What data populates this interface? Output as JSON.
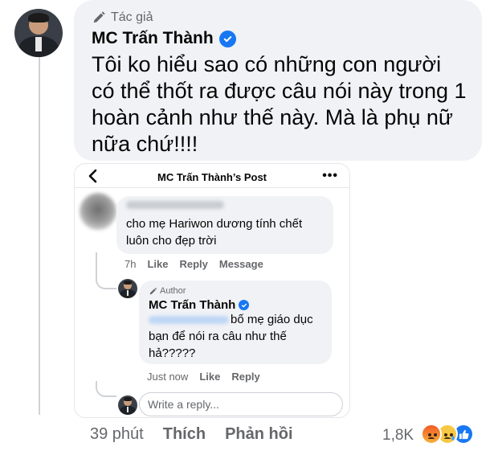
{
  "comment": {
    "badge": "Tác giả",
    "author": "MC Trấn Thành",
    "text": "Tôi ko hiểu sao có những con người có thể thốt ra được câu nói này trong 1 hoàn cảnh như thế này. Mà là phụ nữ nữa chứ!!!!",
    "time": "39 phút",
    "like_label": "Thích",
    "reply_label": "Phản hồi",
    "reaction_count": "1,8K",
    "reactions": [
      "angry-icon",
      "sad-icon",
      "like-icon"
    ]
  },
  "screenshot": {
    "title": "MC Trấn Thành’s Post",
    "comment1": {
      "text": "cho mẹ Hariwon dương tính chết luôn cho đẹp trời",
      "time": "7h",
      "like_label": "Like",
      "reply_label": "Reply",
      "message_label": "Message"
    },
    "reply": {
      "badge": "Author",
      "author": "MC Trấn Thành",
      "text": "bố mẹ giáo dục bạn để nói ra câu như thế hả?????",
      "time": "Just now",
      "like_label": "Like",
      "reply_label": "Reply"
    },
    "reply_input": {
      "placeholder": "Write a reply..."
    }
  },
  "colors": {
    "accent": "#1877f2",
    "bubble": "#f0f2f5",
    "secondary_text": "#65676b"
  }
}
